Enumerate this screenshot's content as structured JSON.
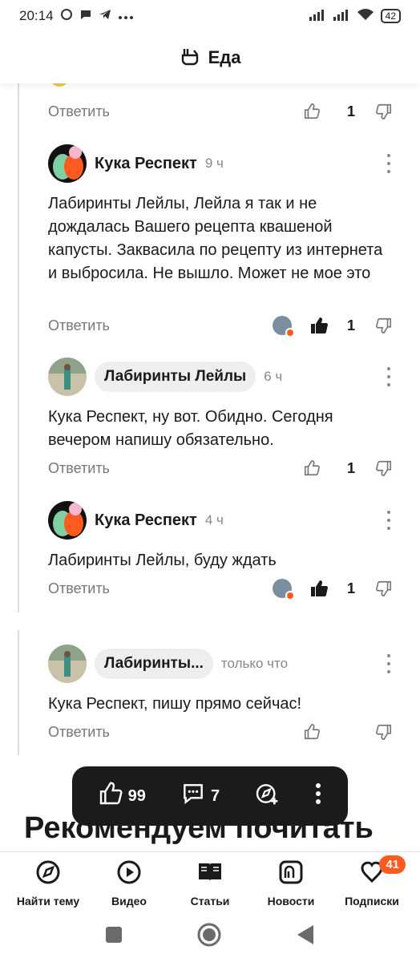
{
  "status": {
    "time": "20:14",
    "battery": "42"
  },
  "header": {
    "title": "Еда"
  },
  "comments": [
    {
      "reply": "Ответить",
      "likes": "1"
    },
    {
      "author": "Кука Респект",
      "time": "9 ч",
      "text": "Лабиринты Лейлы, Лейла я так и не дождалась Вашего рецепта квашеной капусты. Заквасила по рецепту из интернета и выбросила. Не вышло. Может не мое это",
      "reply": "Ответить",
      "likes": "1"
    },
    {
      "author": "Лабиринты Лейлы",
      "time": "6 ч",
      "text": "Кука Респект, ну вот. Обидно. Сегодня вечером напишу обязательно.",
      "reply": "Ответить",
      "likes": "1"
    },
    {
      "author": "Кука Респект",
      "time": "4 ч",
      "text": "Лабиринты Лейлы, буду ждать",
      "reply": "Ответить",
      "likes": "1"
    },
    {
      "author": "Лабиринты...",
      "time": "только что",
      "text": "Кука Респект, пишу прямо сейчас!",
      "reply": "Ответить"
    }
  ],
  "floating_bar": {
    "likes": "99",
    "comments": "7"
  },
  "section": {
    "title": "Рекомендуем почитать"
  },
  "bottom_nav": {
    "items": [
      {
        "label": "Найти тему",
        "icon": "compass-icon"
      },
      {
        "label": "Видео",
        "icon": "play-icon"
      },
      {
        "label": "Статьи",
        "icon": "book-icon"
      },
      {
        "label": "Новости",
        "icon": "news-icon"
      },
      {
        "label": "Подписки",
        "icon": "subscriptions-icon",
        "badge": "41"
      }
    ]
  },
  "colors": {
    "accent": "#ff5a1f",
    "dark_bar": "#1b1b1b"
  }
}
